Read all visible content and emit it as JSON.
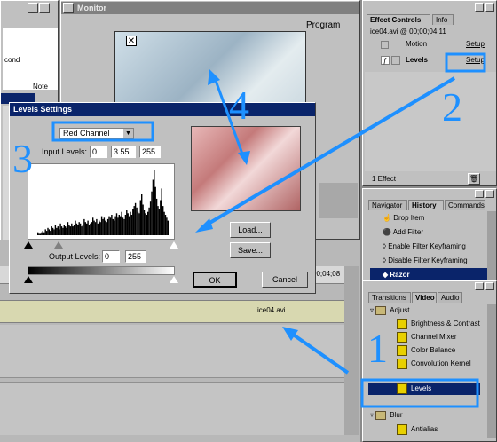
{
  "project_window": {
    "row_label": "cond",
    "tab_label": "Note"
  },
  "monitor": {
    "title": "Monitor",
    "program_label": "Program"
  },
  "effect_controls": {
    "tabs": [
      "Effect Controls",
      "Info"
    ],
    "clip_label": "ice04.avi @ 00;00;04;11",
    "rows": [
      {
        "name": "Motion",
        "setup": "Setup"
      },
      {
        "name": "Levels",
        "setup": "Setup"
      }
    ],
    "status": "1 Effect"
  },
  "history": {
    "tabs": [
      "Navigator",
      "History",
      "Commands"
    ],
    "items": [
      "Drop Item",
      "Add Filter",
      "Enable Filter Keyframing",
      "Disable Filter Keyframing",
      "Razor"
    ],
    "selected": "Razor"
  },
  "video_panel": {
    "tabs": [
      "Transitions",
      "Video",
      "Audio"
    ],
    "items": [
      "Adjust",
      "Brightness & Contrast",
      "Channel Mixer",
      "Color Balance",
      "Convolution Kernel",
      "Levels",
      "Blur",
      "Antialias"
    ],
    "selected": "Levels"
  },
  "timeline": {
    "clip_name": "ice04.avi",
    "timecode": "00;04;08"
  },
  "levels_dialog": {
    "title": "Levels Settings",
    "channel": "Red Channel",
    "input_label": "Input Levels:",
    "input_values": [
      "0",
      "3.55",
      "255"
    ],
    "output_label": "Output Levels:",
    "output_values": [
      "0",
      "255"
    ],
    "load_label": "Load...",
    "save_label": "Save...",
    "ok_label": "OK",
    "cancel_label": "Cancel",
    "histogram_peaks": [
      2,
      1,
      1,
      2,
      3,
      2,
      4,
      3,
      5,
      4,
      3,
      6,
      5,
      4,
      7,
      5,
      6,
      4,
      8,
      6,
      5,
      7,
      6,
      5,
      9,
      7,
      6,
      8,
      6,
      7,
      10,
      8,
      7,
      9,
      8,
      6,
      7,
      11,
      9,
      8,
      10,
      7,
      8,
      9,
      12,
      10,
      9,
      11,
      8,
      10,
      9,
      13,
      11,
      12,
      10,
      9,
      11,
      13,
      12,
      14,
      11,
      10,
      13,
      15,
      12,
      14,
      13,
      16,
      12,
      11,
      14,
      17,
      15,
      13,
      16,
      14,
      18,
      20,
      22,
      19,
      16,
      15,
      24,
      28,
      21,
      17,
      15,
      14,
      16,
      19,
      23,
      30,
      38,
      45,
      33,
      25,
      20,
      18,
      24,
      32,
      20,
      16,
      14,
      12,
      10
    ]
  },
  "callouts": [
    "1",
    "2",
    "3",
    "4"
  ],
  "colors": {
    "accent": "#1e90ff",
    "selection": "#0a246a",
    "panel": "#c0c0c0"
  }
}
